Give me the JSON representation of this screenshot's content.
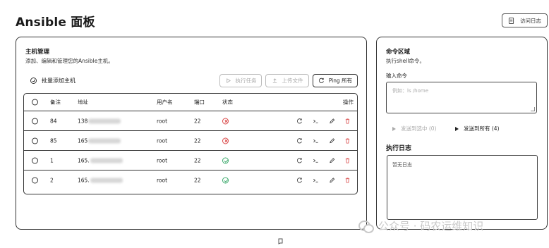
{
  "header": {
    "title": "Ansible 面板",
    "log_button": "访问日志"
  },
  "hosts": {
    "title": "主机管理",
    "description": "添加、编辑和管理您的Ansible主机。",
    "batch_add": "批量添加主机",
    "actions": {
      "run_task": "执行任务",
      "upload_file": "上传文件",
      "ping_all": "Ping 所有"
    },
    "columns": {
      "remark": "备注",
      "address": "地址",
      "username": "用户名",
      "port": "端口",
      "status": "状态",
      "operations": "操作"
    },
    "rows": [
      {
        "remark": "84",
        "address": "138",
        "username": "root",
        "port": "22",
        "status": "offline"
      },
      {
        "remark": "85",
        "address": "165",
        "username": "root",
        "port": "22",
        "status": "offline"
      },
      {
        "remark": "1",
        "address": "165.",
        "username": "root",
        "port": "22",
        "status": "online"
      },
      {
        "remark": "2",
        "address": "165.",
        "username": "root",
        "port": "22",
        "status": "online"
      }
    ]
  },
  "command": {
    "title": "命令区域",
    "description": "执行shell命令。",
    "input_label": "输入命令",
    "input_placeholder": "例如：ls /home",
    "send_selected": "发送到选中 (0)",
    "send_all": "发送到所有 (4)",
    "log_title": "执行日志",
    "log_empty": "暂无日志"
  },
  "watermark": "公众号 · 码农运维知识",
  "colors": {
    "error": "#d94a4a",
    "success": "#3aa86a",
    "border": "#333333"
  },
  "icons": [
    "file-log-icon",
    "plus-circle-icon",
    "play-icon",
    "upload-icon",
    "refresh-icon",
    "terminal-icon",
    "edit-icon",
    "delete-icon",
    "x-circle-icon",
    "check-circle-icon"
  ]
}
